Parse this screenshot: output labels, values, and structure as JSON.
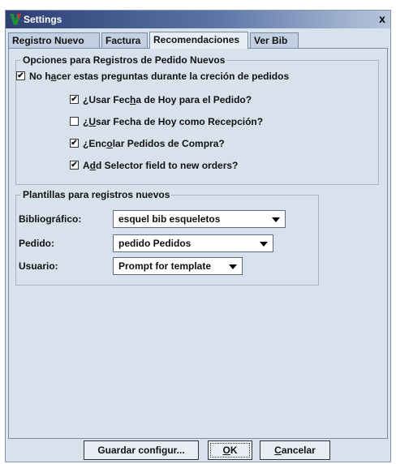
{
  "window": {
    "title": "Settings",
    "close_label": "x"
  },
  "tabs": [
    {
      "label": "Registro Nuevo",
      "active": false
    },
    {
      "label": "Factura",
      "active": false
    },
    {
      "label": "Recomendaciones",
      "active": true
    },
    {
      "label": "Ver Bib",
      "active": false
    }
  ],
  "options_group": {
    "title": "Opciones para Registros de Pedido Nuevos",
    "no_questions": {
      "label": "No hacer estas preguntas durante la creción de pedidos",
      "checked": true
    },
    "items": [
      {
        "label": "¿Usar Fecha de Hoy para el Pedido?",
        "checked": true
      },
      {
        "label": "¿Usar Fecha de Hoy como Recepción?",
        "checked": false
      },
      {
        "label": "¿Encolar Pedidos de Compra?",
        "checked": true
      },
      {
        "label": "Add Selector field to new orders?",
        "checked": true
      }
    ]
  },
  "templates_group": {
    "title": "Plantillas para registros nuevos",
    "rows": [
      {
        "label": "Bibliográfico:",
        "value": "esquel bib esqueletos"
      },
      {
        "label": "Pedido:",
        "value": "pedido Pedidos"
      },
      {
        "label": "Usuario:",
        "value": "Prompt for template"
      }
    ]
  },
  "buttons": {
    "save": "Guardar configur...",
    "ok": "OK",
    "cancel": "Cancelar"
  },
  "icons": {
    "app": "v-logo-icon",
    "close": "close-icon",
    "check": "checkmark-icon",
    "dropdown": "chevron-down-icon"
  }
}
